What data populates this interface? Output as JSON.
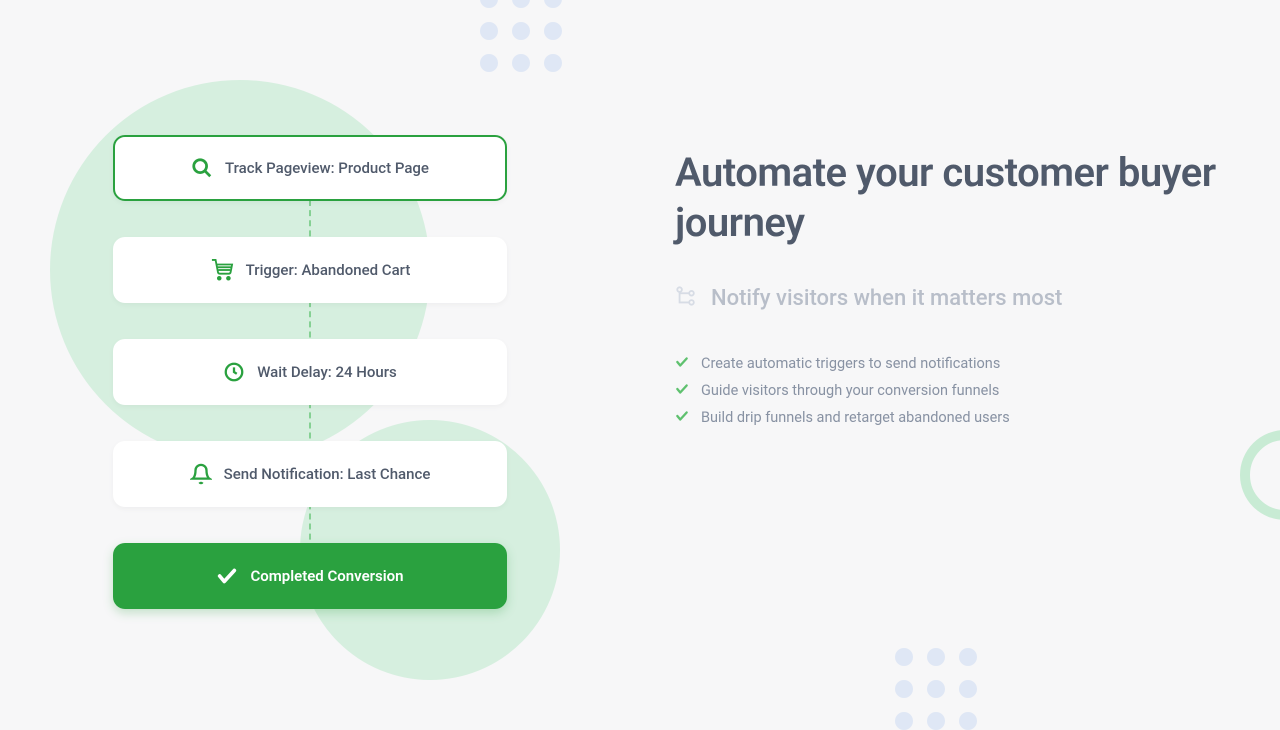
{
  "workflow": {
    "steps": [
      {
        "icon": "search-icon",
        "label": "Track Pageview: Product Page"
      },
      {
        "icon": "cart-icon",
        "label": "Trigger: Abandoned Cart"
      },
      {
        "icon": "clock-icon",
        "label": "Wait Delay: 24 Hours"
      },
      {
        "icon": "bell-icon",
        "label": "Send Notification: Last Chance"
      },
      {
        "icon": "check-icon",
        "label": "Completed Conversion"
      }
    ]
  },
  "content": {
    "title": "Automate your customer buyer journey",
    "subtitle": "Notify visitors when it matters most",
    "benefits": [
      "Create automatic triggers to send notifications",
      "Guide visitors through your conversion funnels",
      "Build drip funnels and retarget abandoned users"
    ]
  },
  "colors": {
    "green": "#2aa13f",
    "lightGreen": "#c8ebd4",
    "textDark": "#505a6b",
    "textLight": "#8892a3"
  }
}
